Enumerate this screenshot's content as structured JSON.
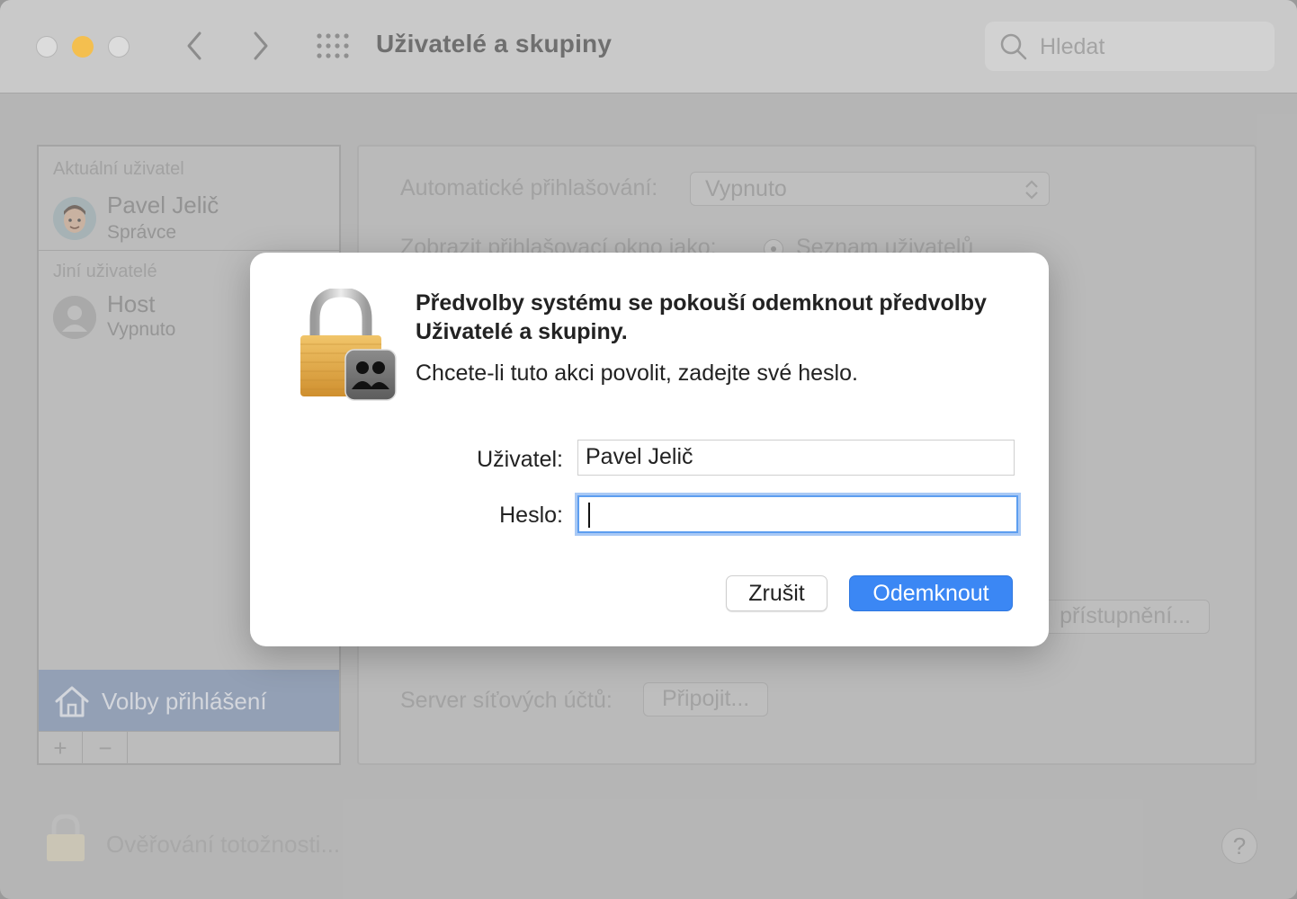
{
  "window": {
    "title": "Uživatelé a skupiny",
    "search_placeholder": "Hledat"
  },
  "sidebar": {
    "current_user_header": "Aktuální uživatel",
    "current_user": {
      "name": "Pavel Jelič",
      "role": "Správce"
    },
    "other_users_header": "Jiní uživatelé",
    "other_user": {
      "name": "Host",
      "status": "Vypnuto"
    },
    "login_options": "Volby přihlášení",
    "add": "+",
    "remove": "−"
  },
  "main": {
    "auto_login_label": "Automatické přihlašování:",
    "auto_login_value": "Vypnuto",
    "show_login_as_label": "Zobrazit přihlašovací okno jako:",
    "show_login_as_value": "Seznam uživatelů",
    "accessibility_button": "přístupnění...",
    "network_server_label": "Server síťových účtů:",
    "connect_button": "Připojit..."
  },
  "footer": {
    "auth_label": "Ověřování totožnosti...",
    "help": "?"
  },
  "dialog": {
    "title": "Předvolby systému se pokouší odemknout předvolby Uživatelé a skupiny.",
    "message": "Chcete-li tuto akci povolit, zadejte své heslo.",
    "user_label": "Uživatel:",
    "user_value": "Pavel Jelič",
    "password_label": "Heslo:",
    "password_value": "",
    "cancel": "Zrušit",
    "unlock": "Odemknout"
  },
  "colors": {
    "accent": "#3b87f4",
    "lock_body": "#e2a94a",
    "traffic_minimize": "#f4bf4f"
  }
}
